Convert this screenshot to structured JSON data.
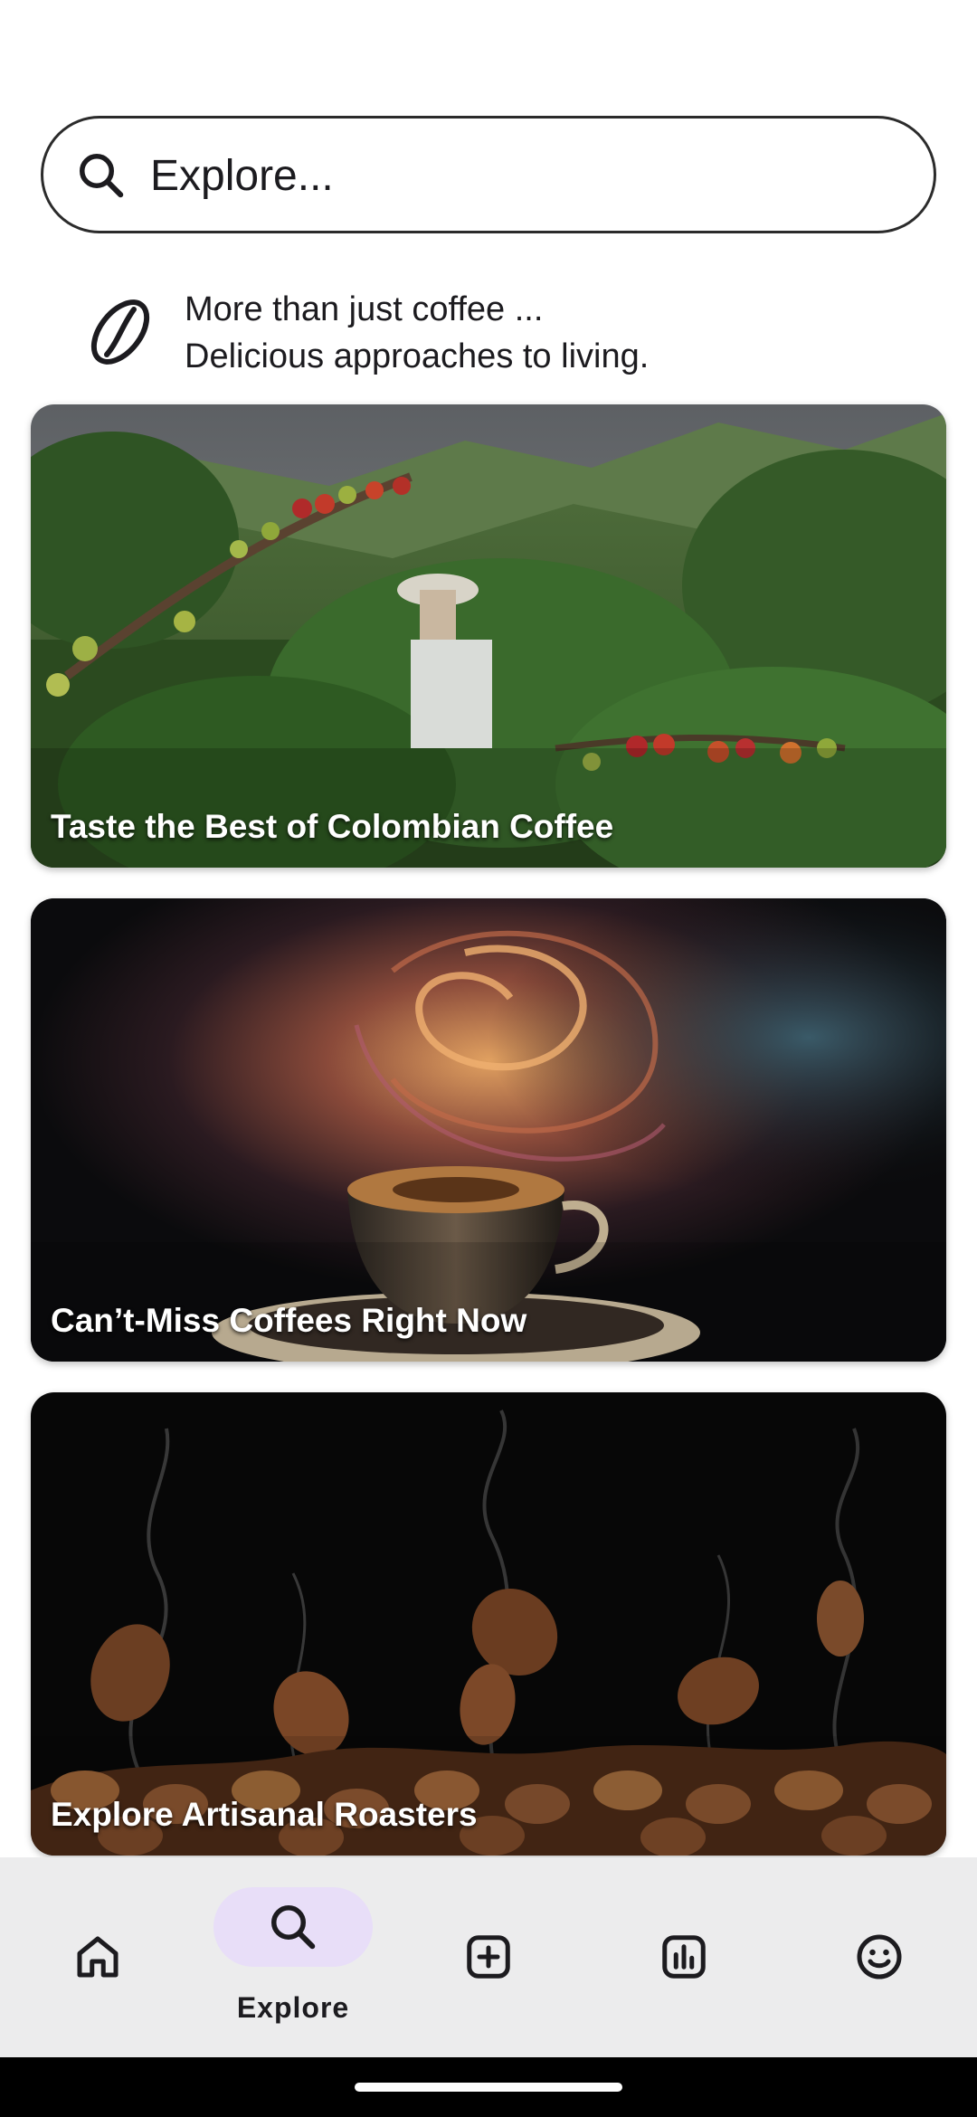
{
  "search": {
    "placeholder": "Explore..."
  },
  "tagline": {
    "line1": "More than just coffee ...",
    "line2": "Delicious approaches to living.",
    "icon": "coffee-bean-icon"
  },
  "cards": [
    {
      "title": "Taste the Best of Colombian Coffee",
      "image": "coffee-plantation-photo"
    },
    {
      "title": "Can’t-Miss Coffees Right Now",
      "image": "galaxy-coffee-cup-photo"
    },
    {
      "title": "Explore Artisanal Roasters",
      "image": "roasted-coffee-beans-photo"
    }
  ],
  "bottom_nav": {
    "active_index": 1,
    "items": [
      {
        "icon": "home-icon",
        "label": ""
      },
      {
        "icon": "search-icon",
        "label": "Explore"
      },
      {
        "icon": "add-box-icon",
        "label": ""
      },
      {
        "icon": "chart-icon",
        "label": ""
      },
      {
        "icon": "smiley-icon",
        "label": ""
      }
    ]
  },
  "colors": {
    "nav_background": "#ececed",
    "active_pill": "#e8def8",
    "text": "#1c1b1f"
  }
}
